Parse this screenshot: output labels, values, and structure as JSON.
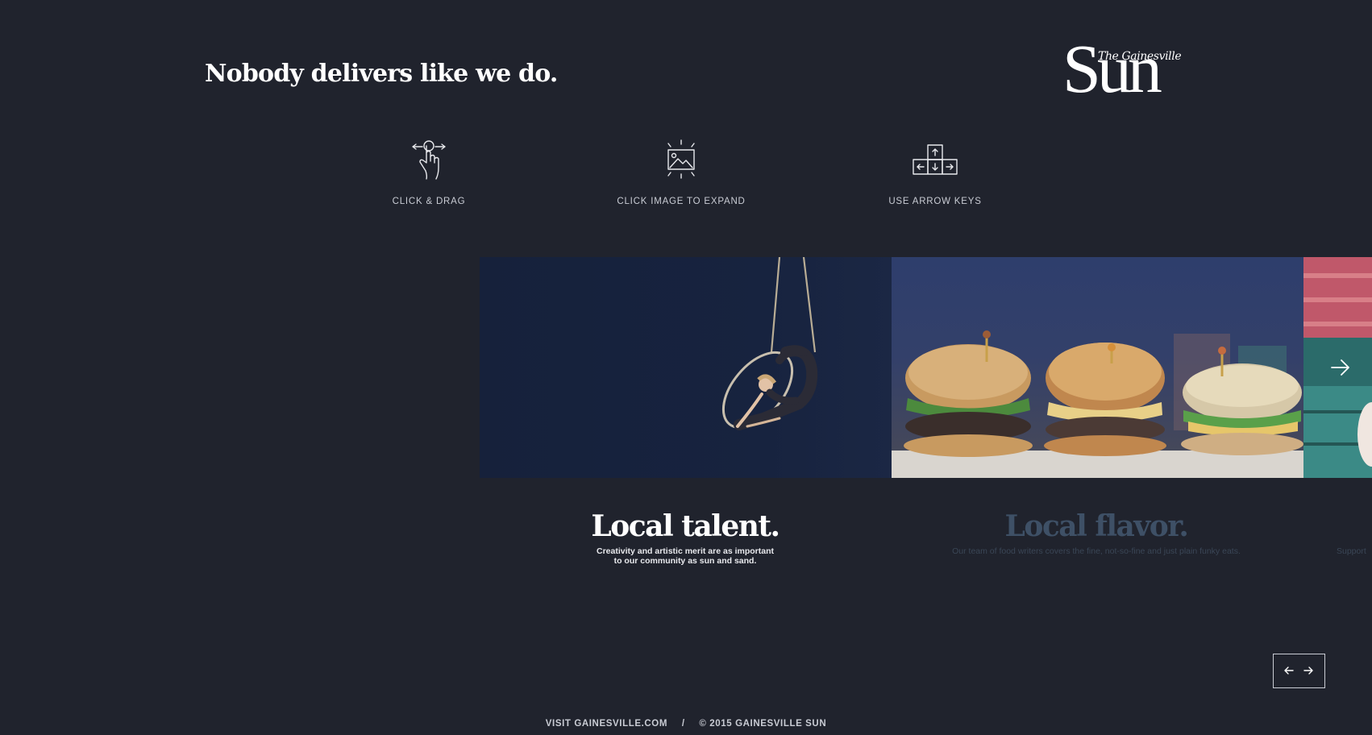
{
  "header": {
    "tagline": "Nobody delivers like we do.",
    "logo": {
      "small_text": "The Gainesville",
      "large_text": "Sun"
    }
  },
  "hints": [
    {
      "icon": "drag-gesture-icon",
      "label": "CLICK & DRAG"
    },
    {
      "icon": "expand-image-icon",
      "label": "CLICK IMAGE TO EXPAND"
    },
    {
      "icon": "arrow-keys-icon",
      "label": "USE ARROW KEYS"
    }
  ],
  "slides": [
    {
      "image": "aerial-hoop-performer-photo",
      "title": "Local talent.",
      "text": "Creativity and artistic merit are as important to our community as sun and sand."
    },
    {
      "image": "burgers-photo",
      "title": "Local flavor.",
      "text": "Our team of food writers covers the fine, not-so-fine and just plain funky eats."
    },
    {
      "image": "stadium-photo",
      "title": "",
      "text": "Support"
    }
  ],
  "navigation": {
    "next_arrow_icon": "arrow-right-icon",
    "prev_icon": "arrow-left-icon",
    "next_icon": "arrow-right-icon"
  },
  "footer": {
    "visit_link": "VISIT GAINESVILLE.COM",
    "separator": "/",
    "copyright": "© 2015 GAINESVILLE SUN"
  },
  "colors": {
    "background": "#20232d",
    "text": "#ffffff",
    "muted_text": "#c9ccd4",
    "inactive_title": "#3e5066"
  }
}
